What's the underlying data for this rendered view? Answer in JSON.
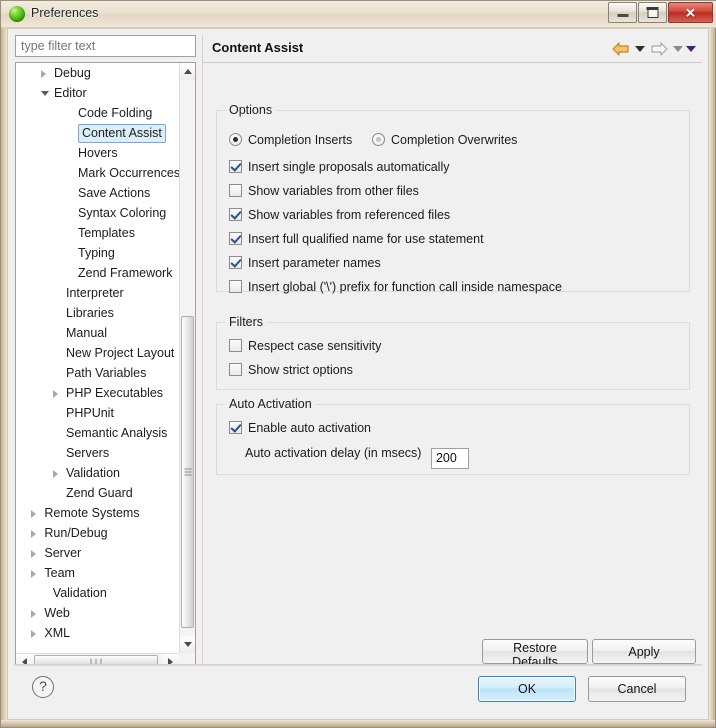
{
  "window": {
    "title": "Preferences",
    "icon": "green-sphere-icon",
    "controls": {
      "minimize": "minimize-button",
      "restore": "restore-button",
      "close": "close-button"
    }
  },
  "sidebar": {
    "filter": {
      "placeholder": "type filter text",
      "value": ""
    },
    "tree": [
      {
        "label": "Debug",
        "indent": 1,
        "state": "collapsed"
      },
      {
        "label": "Editor",
        "indent": 1,
        "state": "expanded"
      },
      {
        "label": "Code Folding",
        "indent": 2,
        "state": "leaf"
      },
      {
        "label": "Content Assist",
        "indent": 2,
        "state": "leaf",
        "selected": true
      },
      {
        "label": "Hovers",
        "indent": 2,
        "state": "leaf"
      },
      {
        "label": "Mark Occurrences",
        "indent": 2,
        "state": "leaf"
      },
      {
        "label": "Save Actions",
        "indent": 2,
        "state": "leaf"
      },
      {
        "label": "Syntax Coloring",
        "indent": 2,
        "state": "leaf"
      },
      {
        "label": "Templates",
        "indent": 2,
        "state": "leaf"
      },
      {
        "label": "Typing",
        "indent": 2,
        "state": "leaf"
      },
      {
        "label": "Zend Framework",
        "indent": 2,
        "state": "leaf"
      },
      {
        "label": "Interpreter",
        "indent": 1.5,
        "state": "leaf"
      },
      {
        "label": "Libraries",
        "indent": 1.5,
        "state": "leaf"
      },
      {
        "label": "Manual",
        "indent": 1.5,
        "state": "leaf"
      },
      {
        "label": "New Project Layout",
        "indent": 1.5,
        "state": "leaf"
      },
      {
        "label": "Path Variables",
        "indent": 1.5,
        "state": "leaf"
      },
      {
        "label": "PHP Executables",
        "indent": 1.5,
        "state": "collapsed"
      },
      {
        "label": "PHPUnit",
        "indent": 1.5,
        "state": "leaf"
      },
      {
        "label": "Semantic Analysis",
        "indent": 1.5,
        "state": "leaf"
      },
      {
        "label": "Servers",
        "indent": 1.5,
        "state": "leaf"
      },
      {
        "label": "Validation",
        "indent": 1.5,
        "state": "collapsed"
      },
      {
        "label": "Zend Guard",
        "indent": 1.5,
        "state": "leaf"
      },
      {
        "label": "Remote Systems",
        "indent": 0.6,
        "state": "collapsed"
      },
      {
        "label": "Run/Debug",
        "indent": 0.6,
        "state": "collapsed"
      },
      {
        "label": "Server",
        "indent": 0.6,
        "state": "collapsed"
      },
      {
        "label": "Team",
        "indent": 0.6,
        "state": "collapsed"
      },
      {
        "label": "Validation",
        "indent": 0.95,
        "state": "leaf"
      },
      {
        "label": "Web",
        "indent": 0.6,
        "state": "collapsed"
      },
      {
        "label": "XML",
        "indent": 0.6,
        "state": "collapsed"
      }
    ]
  },
  "content": {
    "title": "Content Assist",
    "nav": {
      "back": "back-arrow-icon",
      "back_menu": "back-dropdown-icon",
      "forward": "forward-arrow-icon",
      "forward_menu": "forward-dropdown-icon",
      "view_menu": "view-menu-icon"
    },
    "groups": [
      {
        "title": "Options",
        "radios": [
          {
            "label": "Completion Inserts",
            "checked": true
          },
          {
            "label": "Completion Overwrites",
            "checked": false
          }
        ],
        "checkboxes": [
          {
            "label": "Insert single proposals automatically",
            "checked": true
          },
          {
            "label": "Show variables from other files",
            "checked": false
          },
          {
            "label": "Show variables from referenced files",
            "checked": true
          },
          {
            "label": "Insert full qualified name for use statement",
            "checked": true
          },
          {
            "label": "Insert parameter names",
            "checked": true
          },
          {
            "label": "Insert global ('\\') prefix for function call inside namespace",
            "checked": false
          }
        ]
      },
      {
        "title": "Filters",
        "checkboxes": [
          {
            "label": "Respect case sensitivity",
            "checked": false
          },
          {
            "label": "Show strict options",
            "checked": false
          }
        ]
      },
      {
        "title": "Auto Activation",
        "checkboxes": [
          {
            "label": "Enable auto activation",
            "checked": true
          }
        ],
        "delay": {
          "label": "Auto activation delay (in msecs)",
          "value": "200"
        }
      }
    ],
    "buttons": {
      "restore_defaults": "Restore Defaults",
      "apply": "Apply"
    }
  },
  "footer": {
    "help": "?",
    "ok": "OK",
    "cancel": "Cancel"
  },
  "colors": {
    "accent": "#2c86d4",
    "selection_bg": "#ddeefb",
    "selection_border": "#7ba7cf",
    "back_arrow": "#e8a33d",
    "menu_arrow": "#4b1f6f",
    "close_button": "#d1453a"
  }
}
